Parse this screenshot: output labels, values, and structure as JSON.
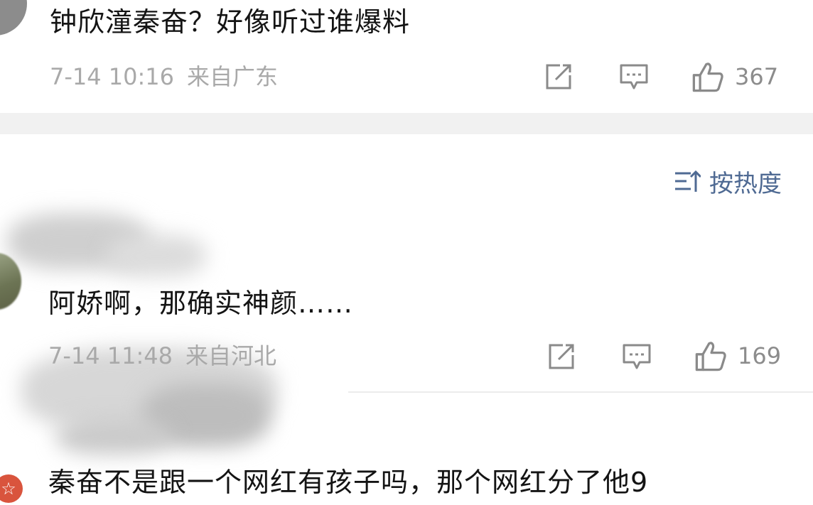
{
  "comments": [
    {
      "text": "钟欣潼秦奋？好像听过谁爆料",
      "date": "7-14 10:16",
      "location": "来自广东",
      "likes": "367"
    },
    {
      "text": "阿娇啊，那确实神颜……",
      "date": "7-14 11:48",
      "location": "来自河北",
      "likes": "169"
    },
    {
      "text": "秦奋不是跟一个网红有孩子吗，那个网红分了他9"
    }
  ],
  "sort": {
    "label": "按热度",
    "icon": "sort-icon"
  },
  "icons": {
    "share": "share-icon",
    "comment": "comment-icon",
    "like": "thumbs-up-icon",
    "badge": "star-icon"
  },
  "colors": {
    "accent": "#4f6a93",
    "meta": "#a9a9a9",
    "separator": "#f1f1f1",
    "badge": "#d9543d"
  }
}
